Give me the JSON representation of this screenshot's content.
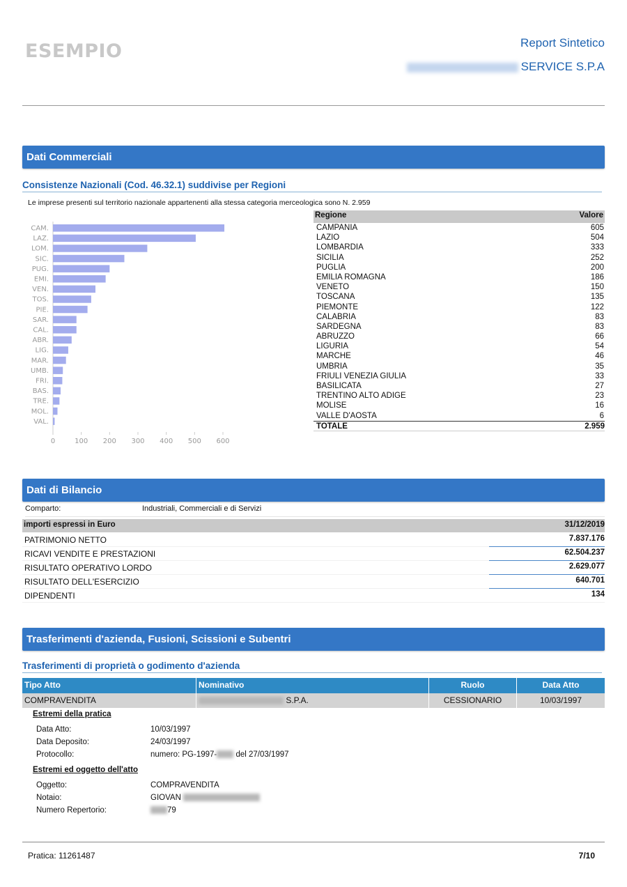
{
  "header": {
    "watermark": "ESEMPIO",
    "report_title": "Report Sintetico",
    "company_visible": "SERVICE S.P.A"
  },
  "commerciali": {
    "section_title": "Dati Commerciali",
    "subtitle": "Consistenze Nazionali (Cod. 46.32.1) suddivise per Regioni",
    "note": "Le imprese presenti sul territorio nazionale appartenenti alla stessa categoria merceologica sono N. 2.959",
    "table_headers": [
      "Regione",
      "Valore"
    ],
    "regions": [
      {
        "name": "CAMPANIA",
        "value": "605"
      },
      {
        "name": "LAZIO",
        "value": "504"
      },
      {
        "name": "LOMBARDIA",
        "value": "333"
      },
      {
        "name": "SICILIA",
        "value": "252"
      },
      {
        "name": "PUGLIA",
        "value": "200"
      },
      {
        "name": "EMILIA ROMAGNA",
        "value": "186"
      },
      {
        "name": "VENETO",
        "value": "150"
      },
      {
        "name": "TOSCANA",
        "value": "135"
      },
      {
        "name": "PIEMONTE",
        "value": "122"
      },
      {
        "name": "CALABRIA",
        "value": "83"
      },
      {
        "name": "SARDEGNA",
        "value": "83"
      },
      {
        "name": "ABRUZZO",
        "value": "66"
      },
      {
        "name": "LIGURIA",
        "value": "54"
      },
      {
        "name": "MARCHE",
        "value": "46"
      },
      {
        "name": "UMBRIA",
        "value": "35"
      },
      {
        "name": "FRIULI VENEZIA GIULIA",
        "value": "33"
      },
      {
        "name": "BASILICATA",
        "value": "27"
      },
      {
        "name": "TRENTINO ALTO ADIGE",
        "value": "23"
      },
      {
        "name": "MOLISE",
        "value": "16"
      },
      {
        "name": "VALLE D'AOSTA",
        "value": "6"
      }
    ],
    "total_label": "TOTALE",
    "total_value": "2.959"
  },
  "chart_data": {
    "type": "bar",
    "orientation": "horizontal",
    "categories": [
      "CAM.",
      "LAZ.",
      "LOM.",
      "SIC.",
      "PUG.",
      "EMI.",
      "VEN.",
      "TOS.",
      "PIE.",
      "SAR.",
      "CAL.",
      "ABR.",
      "LIG.",
      "MAR.",
      "UMB.",
      "FRI.",
      "BAS.",
      "TRE.",
      "MOL.",
      "VAL."
    ],
    "values": [
      605,
      504,
      333,
      252,
      200,
      186,
      150,
      135,
      122,
      83,
      83,
      66,
      54,
      46,
      35,
      33,
      27,
      23,
      16,
      6
    ],
    "xlim": [
      0,
      600
    ],
    "xticks": [
      "0",
      "100",
      "200",
      "300",
      "400",
      "500",
      "600"
    ],
    "bar_color": "#a3aced",
    "title": "",
    "xlabel": "",
    "ylabel": ""
  },
  "bilancio": {
    "section_title": "Dati di Bilancio",
    "comparto_label": "Comparto:",
    "comparto_value": "Industriali, Commerciali e di Servizi",
    "head_left": "importi espressi in Euro",
    "head_right": "31/12/2019",
    "rows": [
      {
        "label": "PATRIMONIO NETTO",
        "value": "7.837.176"
      },
      {
        "label": "RICAVI VENDITE E PRESTAZIONI",
        "value": "62.504.237"
      },
      {
        "label": "RISULTATO OPERATIVO LORDO",
        "value": "2.629.077"
      },
      {
        "label": "RISULTATO DELL'ESERCIZIO",
        "value": "640.701"
      },
      {
        "label": "DIPENDENTI",
        "value": "134"
      }
    ]
  },
  "trasferimenti": {
    "section_title": "Trasferimenti d'azienda, Fusioni, Scissioni e Subentri",
    "subtitle": "Trasferimenti di proprietà o godimento d'azienda",
    "headers": [
      "Tipo Atto",
      "Nominativo",
      "Ruolo",
      "Data Atto"
    ],
    "row": {
      "tipo": "COMPRAVENDITA",
      "nominativo_visible": "S.P.A.",
      "ruolo": "CESSIONARIO",
      "data": "10/03/1997"
    },
    "pratica_title": "Estremi della pratica",
    "pratica": [
      {
        "label": "Data Atto:",
        "value": "10/03/1997"
      },
      {
        "label": "Data Deposito:",
        "value": "24/03/1997"
      }
    ],
    "protocollo_label": "Protocollo:",
    "protocollo_prefix": "numero:  PG-1997-",
    "protocollo_suffix": " del  27/03/1997",
    "oggetto_title": "Estremi ed oggetto dell'atto",
    "oggetto_label": "Oggetto:",
    "oggetto_value": "COMPRAVENDITA",
    "notaio_label": "Notaio:",
    "notaio_visible": "GIOVAN",
    "repertorio_label": "Numero Repertorio:",
    "repertorio_visible": "79"
  },
  "footer": {
    "pratica": "Pratica: 11261487",
    "page": "7/10"
  }
}
